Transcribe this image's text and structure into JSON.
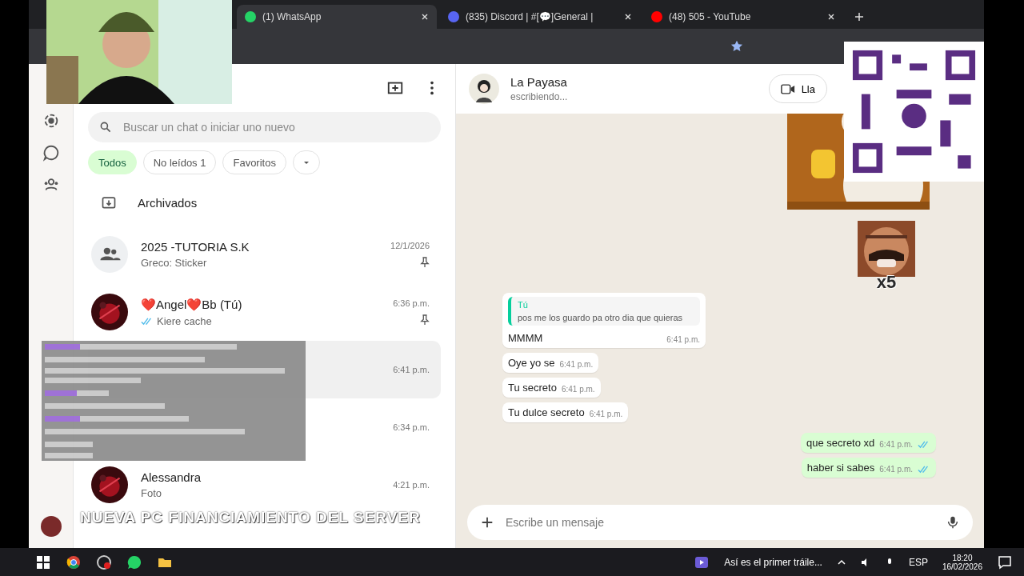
{
  "browser": {
    "tabs": [
      {
        "title": "(1) WhatsApp",
        "selected": true,
        "kind": "whatsapp"
      },
      {
        "title": "(835) Discord | #[💬]General |",
        "selected": false,
        "kind": "discord"
      },
      {
        "title": "(48) 505 - YouTube",
        "selected": false,
        "kind": "youtube"
      }
    ]
  },
  "chat_list": {
    "search": {
      "placeholder": "Buscar un chat o iniciar uno nuevo"
    },
    "filters": [
      {
        "label": "Todos",
        "selected": true
      },
      {
        "label": "No leídos 1",
        "selected": false
      },
      {
        "label": "Favoritos",
        "selected": false
      }
    ],
    "archived": "Archivados",
    "chats": [
      {
        "name": "2025 -TUTORIA S.K",
        "preview": "Greco: Sticker",
        "time": "12/1/2026",
        "pinned": true,
        "read": false,
        "selected": false,
        "kind": "group"
      },
      {
        "name": "❤️Angel❤️Bb (Tú)",
        "preview": "Kiere cache",
        "time": "6:36 p.m.",
        "pinned": true,
        "read": true,
        "selected": false
      },
      {
        "time": "6:41 p.m.",
        "selected": true,
        "kind": "hidden"
      },
      {
        "time": "6:34 p.m.",
        "selected": false,
        "kind": "hidden"
      },
      {
        "name": "Alessandra",
        "preview": "Foto",
        "time": "4:21 p.m.",
        "pinned": false,
        "read": false,
        "selected": false
      }
    ]
  },
  "chat": {
    "name": "La Payasa",
    "status": "escribiendo...",
    "call_label": "Lla",
    "sticker_count": "x5",
    "messages": [
      {
        "kind": "in",
        "quote_author": "Tú",
        "quote": "pos me los guardo pa otro dia que quieras",
        "text": "MMMM",
        "time": "6:41 p.m."
      },
      {
        "kind": "in",
        "text": "Oye yo se",
        "time": "6:41 p.m."
      },
      {
        "kind": "in",
        "text": "Tu secreto",
        "time": "6:41 p.m."
      },
      {
        "kind": "in",
        "text": "Tu dulce secreto",
        "time": "6:41 p.m."
      },
      {
        "kind": "out",
        "text": "que secreto xd",
        "time": "6:41 p.m.",
        "read": true
      },
      {
        "kind": "out",
        "text": "haber si sabes",
        "time": "6:41 p.m.",
        "read": true
      }
    ],
    "composer": {
      "placeholder": "Escribe un mensaje"
    }
  },
  "banner": "NUEVA PC FINANCIAMIENTO DEL SERVER",
  "taskbar": {
    "media": "Así es el primer tráile...",
    "language": "ESP",
    "time": "18:20",
    "date": "16/02/2026"
  }
}
